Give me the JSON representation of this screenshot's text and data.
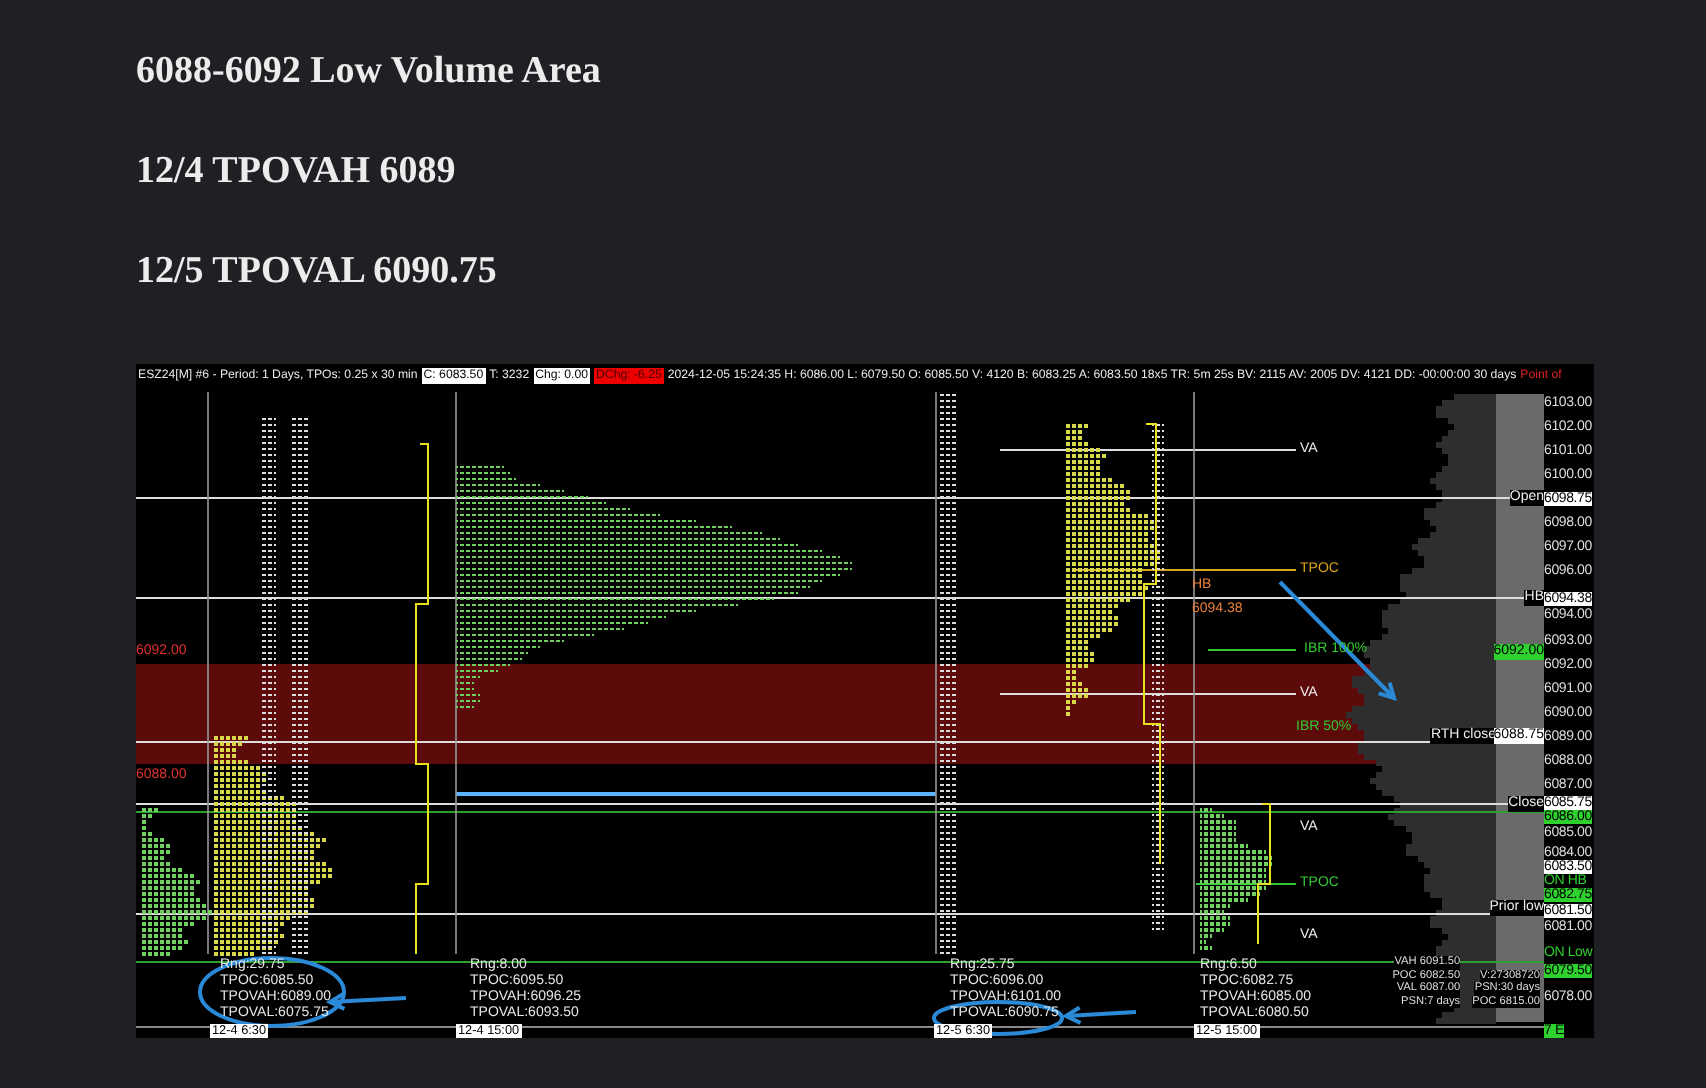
{
  "headings": [
    "6088-6092 Low Volume Area",
    "12/4 TPOVAH 6089",
    "12/5 TPOVAL 6090.75"
  ],
  "chart": {
    "header": [
      {
        "text": "ESZ24[M] #6 - Period: 1 Days, TPOs: 0.25 x 30 min",
        "kind": "plain"
      },
      {
        "text": "C: 6083.50",
        "kind": "boxed"
      },
      {
        "text": "T: 3232",
        "kind": "plain"
      },
      {
        "text": "Chg: 0.00",
        "kind": "boxed"
      },
      {
        "text": "DChg: -6.25",
        "kind": "alert"
      },
      {
        "text": "2024-12-05 15:24:35 H: 6086.00 L: 6079.50 O: 6085.50 V: 4120 B: 6083.25 A: 6083.50 18x5 TR: 5m 25s BV: 2115 AV: 2005 DV: 4121 DD: -00:00:00 30 days",
        "kind": "plain"
      },
      {
        "text": "Point of",
        "kind": "warning"
      }
    ],
    "price_axis": [
      {
        "text": "6103.00",
        "kind": "plain"
      },
      {
        "text": "6102.00",
        "kind": "plain"
      },
      {
        "text": "6101.00",
        "kind": "plain"
      },
      {
        "text": "6100.00",
        "kind": "plain"
      },
      {
        "text": "6098.75",
        "kind": "white"
      },
      {
        "text": "6098.00",
        "kind": "plain"
      },
      {
        "text": "6097.00",
        "kind": "plain"
      },
      {
        "text": "6096.00",
        "kind": "plain"
      },
      {
        "text": "6094.38",
        "kind": "white"
      },
      {
        "text": "6094.00",
        "kind": "plain"
      },
      {
        "text": "6093.00",
        "kind": "plain"
      },
      {
        "text": "6092.00",
        "kind": "plain"
      },
      {
        "text": "6091.00",
        "kind": "plain"
      },
      {
        "text": "6090.00",
        "kind": "plain"
      },
      {
        "text": "6089.00",
        "kind": "plain"
      },
      {
        "text": "6088.00",
        "kind": "plain"
      },
      {
        "text": "6087.00",
        "kind": "plain"
      },
      {
        "text": "6085.75",
        "kind": "white"
      },
      {
        "text": "6086.00",
        "kind": "green"
      },
      {
        "text": "6085.00",
        "kind": "plain"
      },
      {
        "text": "6084.00",
        "kind": "plain"
      },
      {
        "text": "6083.50",
        "kind": "white"
      },
      {
        "text": "ON HB",
        "kind": "green_text"
      },
      {
        "text": "6082.75",
        "kind": "green"
      },
      {
        "text": "6081.50",
        "kind": "white"
      },
      {
        "text": "6081.00",
        "kind": "plain"
      },
      {
        "text": "ON Low",
        "kind": "green_text"
      },
      {
        "text": "6079.50",
        "kind": "green"
      },
      {
        "text": "6078.00",
        "kind": "plain"
      },
      {
        "text": "7 E",
        "kind": "green"
      }
    ],
    "levels": [
      {
        "text": "VA",
        "kind": "va"
      },
      {
        "text": "TPOC",
        "kind": "tpoc"
      },
      {
        "text": "HB",
        "kind": "hb"
      },
      {
        "text": "6094.38",
        "kind": "hb"
      },
      {
        "text": "IBR 100%",
        "kind": "ibr"
      },
      {
        "text": "VA",
        "kind": "va"
      },
      {
        "text": "IBR 50%",
        "kind": "ibr"
      },
      {
        "text": "VA",
        "kind": "va"
      },
      {
        "text": "TPOC",
        "kind": "ibr"
      },
      {
        "text": "VA",
        "kind": "va"
      },
      {
        "text": "Open",
        "kind": "marker"
      },
      {
        "text": "HB",
        "kind": "marker"
      },
      {
        "text": "6092.00",
        "kind": "green_box"
      },
      {
        "text": "RTH close",
        "kind": "marker"
      },
      {
        "text": "6088.75",
        "kind": "white_box"
      },
      {
        "text": "Close",
        "kind": "marker"
      },
      {
        "text": "Prior low",
        "kind": "marker"
      },
      {
        "text": "6092.00",
        "kind": "left_price"
      },
      {
        "text": "6088.00",
        "kind": "left_price"
      }
    ],
    "session_stats": [
      {
        "lines": [
          "Rng:29.75",
          "TPOC:6085.50",
          "TPOVAH:6089.00",
          "TPOVAL:6075.75"
        ]
      },
      {
        "lines": [
          "Rng:8.00",
          "TPOC:6095.50",
          "TPOVAH:6096.25",
          "TPOVAL:6093.50"
        ]
      },
      {
        "lines": [
          "Rng:25.75",
          "TPOC:6096.00",
          "TPOVAH:6101.00",
          "TPOVAL:6090.75"
        ]
      },
      {
        "lines": [
          "Rng:6.50",
          "TPOC:6082.75",
          "TPOVAH:6085.00",
          "TPOVAL:6080.50"
        ]
      }
    ],
    "summary": {
      "left": [
        "VAH 6091.50",
        "POC 6082.50",
        "VAL 6087.00",
        "PSN:7 days"
      ],
      "right": [
        "V:27308720",
        "PSN:30 days",
        "POC 6815.00"
      ]
    },
    "date_labels": [
      "12-4 6:30",
      "12-4 15:00",
      "12-5 6:30",
      "12-5 15:00"
    ]
  }
}
